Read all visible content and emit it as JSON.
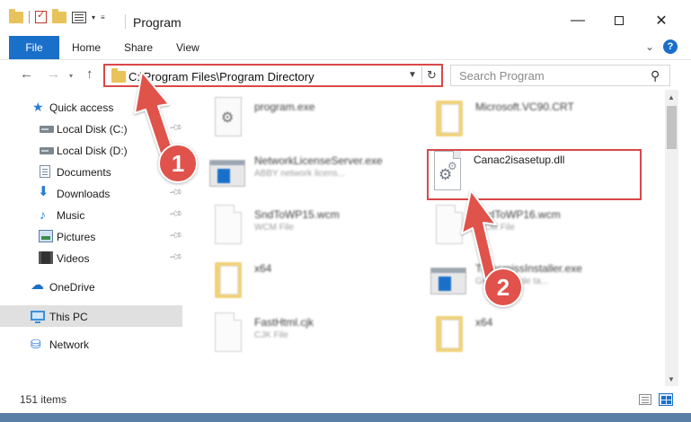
{
  "window": {
    "title": "Program",
    "controls": {
      "minimize": "—",
      "maximize": "",
      "close": "✕"
    }
  },
  "ribbon": {
    "tabs": [
      "File",
      "Home",
      "Share",
      "View"
    ],
    "help": "?"
  },
  "address_bar": {
    "path": "C:\\Program Files\\Program Directory",
    "search_placeholder": "Search Program"
  },
  "sidebar": {
    "items": [
      {
        "label": "Quick access",
        "icon": "star-icon",
        "pinned": false
      },
      {
        "label": "Local Disk (C:)",
        "icon": "drive-icon",
        "pinned": true
      },
      {
        "label": "Local Disk (D:)",
        "icon": "drive-icon",
        "pinned": false
      },
      {
        "label": "Documents",
        "icon": "documents-icon",
        "pinned": false
      },
      {
        "label": "Downloads",
        "icon": "download-icon",
        "pinned": true
      },
      {
        "label": "Music",
        "icon": "music-icon",
        "pinned": true
      },
      {
        "label": "Pictures",
        "icon": "pictures-icon",
        "pinned": true
      },
      {
        "label": "Videos",
        "icon": "videos-icon",
        "pinned": true
      },
      {
        "label": "OneDrive",
        "icon": "cloud-icon",
        "pinned": false
      },
      {
        "label": "This PC",
        "icon": "computer-icon",
        "pinned": false,
        "selected": true
      },
      {
        "label": "Network",
        "icon": "network-icon",
        "pinned": false
      }
    ]
  },
  "files": [
    {
      "name": "program.exe",
      "desc": "",
      "type": "exe"
    },
    {
      "name": "Microsoft.VC90.CRT",
      "desc": "",
      "type": "folder"
    },
    {
      "name": "NetworkLicenseServer.exe",
      "desc": "ABBY network licens...",
      "type": "app"
    },
    {
      "name": "Canac2isasetup.dll",
      "desc": "",
      "type": "dll",
      "highlighted": true
    },
    {
      "name": "SndToWP15.wcm",
      "desc": "WCM File",
      "type": "doc"
    },
    {
      "name": "SndToWP16.wcm",
      "desc": "WCM File",
      "type": "doc"
    },
    {
      "name": "x64",
      "desc": "",
      "type": "folder"
    },
    {
      "name": "TransmissInstaller.exe",
      "desc": "Generador de ta...",
      "type": "app"
    },
    {
      "name": "FastHtml.cjk",
      "desc": "CJK File",
      "type": "doc"
    },
    {
      "name": "x64",
      "desc": "",
      "type": "folder"
    }
  ],
  "status": {
    "item_count": "151 items"
  },
  "annotations": {
    "step1": "1",
    "step2": "2",
    "color": "#e0524b"
  },
  "colors": {
    "accent": "#1a6fc9",
    "highlight_border": "#d94848"
  }
}
